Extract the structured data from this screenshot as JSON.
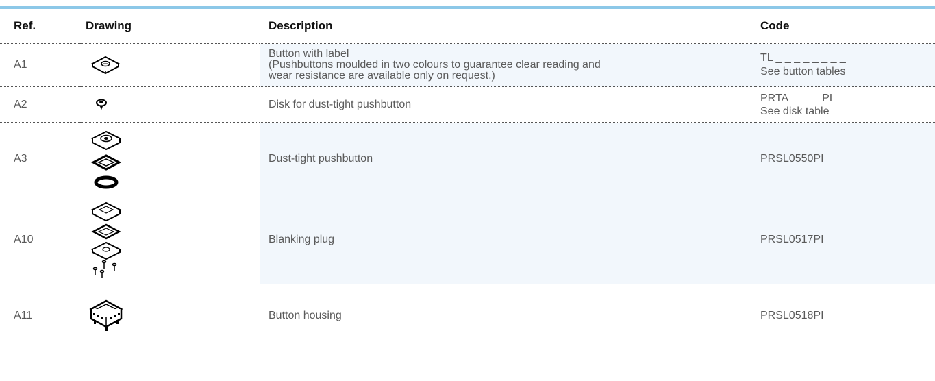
{
  "table": {
    "headers": {
      "ref": "Ref.",
      "drawing": "Drawing",
      "description": "Description",
      "code": "Code"
    },
    "rows": [
      {
        "ref": "A1",
        "drawing_icon": "button-with-label-icon",
        "description_lines": [
          "Button with label",
          "(Pushbuttons moulded in two colours to guarantee clear reading and",
          "wear resistance are available only on request.)"
        ],
        "code_lines": [
          "TL _ _ _ _ _ _ _ _",
          "See button tables"
        ]
      },
      {
        "ref": "A2",
        "drawing_icon": "disk-icon",
        "description_lines": [
          "Disk for dust-tight pushbutton"
        ],
        "code_lines": [
          "PRTA_ _ _ _PI",
          "See disk table"
        ]
      },
      {
        "ref": "A3",
        "drawing_icon": "dust-tight-pushbutton-icon",
        "description_lines": [
          "Dust-tight pushbutton"
        ],
        "code_lines": [
          "PRSL0550PI"
        ]
      },
      {
        "ref": "A10",
        "drawing_icon": "blanking-plug-icon",
        "description_lines": [
          "Blanking plug"
        ],
        "code_lines": [
          "PRSL0517PI"
        ]
      },
      {
        "ref": "A11",
        "drawing_icon": "button-housing-icon",
        "description_lines": [
          "Button housing"
        ],
        "code_lines": [
          "PRSL0518PI"
        ]
      }
    ]
  },
  "colors": {
    "accent_rule": "#8cc8e8",
    "row_shade": "#f2f7fc",
    "text": "#5a5a5a",
    "header_text": "#111111"
  }
}
